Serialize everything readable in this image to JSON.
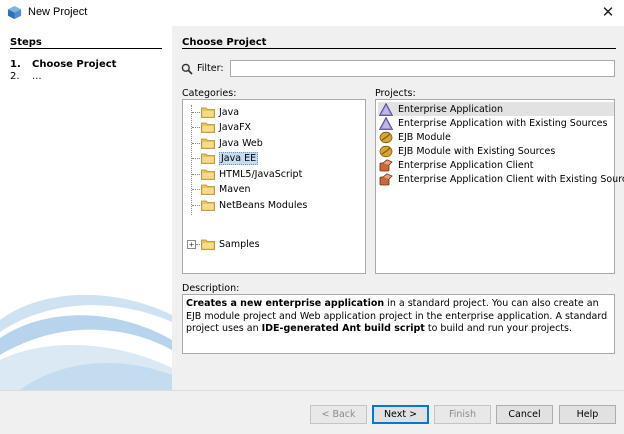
{
  "window": {
    "title": "New Project",
    "icon": "netbeans-cube-icon"
  },
  "steps": {
    "title": "Steps",
    "items": [
      {
        "num": "1.",
        "label": "Choose Project"
      },
      {
        "num": "2.",
        "label": "..."
      }
    ]
  },
  "main": {
    "title": "Choose Project",
    "filter": {
      "label": "Filter:",
      "value": "",
      "placeholder": ""
    },
    "categories_label": "Categories:",
    "categories": [
      "Java",
      "JavaFX",
      "Java Web",
      "Java EE",
      "HTML5/JavaScript",
      "Maven",
      "NetBeans Modules",
      "Samples"
    ],
    "selected_category": "Java EE",
    "projects_label": "Projects:",
    "projects": [
      {
        "label": "Enterprise Application",
        "icon": "triangle-icon"
      },
      {
        "label": "Enterprise Application with Existing Sources",
        "icon": "triangle-icon"
      },
      {
        "label": "EJB Module",
        "icon": "bean-icon"
      },
      {
        "label": "EJB Module with Existing Sources",
        "icon": "bean-icon"
      },
      {
        "label": "Enterprise Application Client",
        "icon": "client-icon"
      },
      {
        "label": "Enterprise Application Client with Existing Sources",
        "icon": "client-icon"
      }
    ],
    "selected_project": "Enterprise Application",
    "description_label": "Description:",
    "description": {
      "bold1": "Creates a new enterprise application",
      "text1": " in a standard project. You can also create an EJB module project and Web application project in the enterprise application. A standard project uses an ",
      "bold2": "IDE-generated Ant build script",
      "text2": " to build and run your projects."
    }
  },
  "buttons": {
    "back": "< Back",
    "next": "Next >",
    "finish": "Finish",
    "cancel": "Cancel",
    "help": "Help"
  },
  "colors": {
    "selection": "#c7dcf2",
    "default_button_border": "#0078d7",
    "left_panel": "#ffffff",
    "dialog_bg": "#f0f0f0"
  }
}
